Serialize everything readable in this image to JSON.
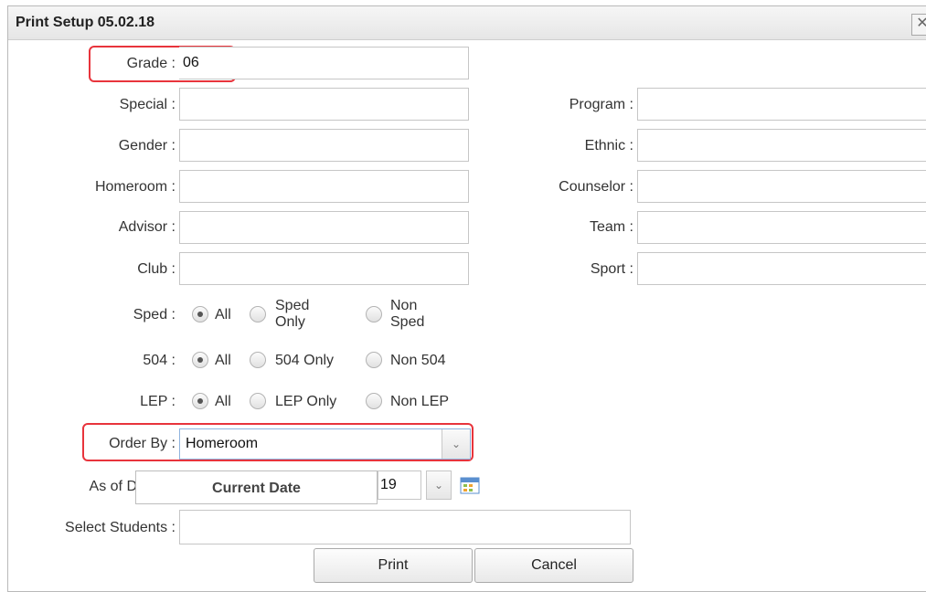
{
  "dialog": {
    "title": "Print Setup 05.02.18",
    "close_glyph": "✕"
  },
  "fields": {
    "grade": {
      "label": "Grade :",
      "value": "06"
    },
    "special": {
      "label": "Special :",
      "value": ""
    },
    "gender": {
      "label": "Gender :",
      "value": ""
    },
    "homeroom": {
      "label": "Homeroom :",
      "value": ""
    },
    "advisor": {
      "label": "Advisor :",
      "value": ""
    },
    "club": {
      "label": "Club :",
      "value": ""
    },
    "program": {
      "label": "Program :",
      "value": ""
    },
    "ethnic": {
      "label": "Ethnic :",
      "value": ""
    },
    "counselor": {
      "label": "Counselor :",
      "value": ""
    },
    "team": {
      "label": "Team :",
      "value": ""
    },
    "sport": {
      "label": "Sport :",
      "value": ""
    }
  },
  "radios": {
    "sped": {
      "label": "Sped :",
      "options": [
        "All",
        "Sped Only",
        "Non Sped"
      ],
      "opt2_line1": "Sped",
      "opt2_line2": "Only",
      "opt3_line1": "Non",
      "opt3_line2": "Sped",
      "selected": "All"
    },
    "504": {
      "label": "504 :",
      "options": [
        "All",
        "504 Only",
        "Non 504"
      ],
      "selected": "All"
    },
    "lep": {
      "label": "LEP :",
      "options": [
        "All",
        "LEP Only",
        "Non LEP"
      ],
      "selected": "All"
    }
  },
  "order_by": {
    "label": "Order By :",
    "value": "Homeroom"
  },
  "as_of": {
    "label_visible": "As of D",
    "overlay_text": "Current Date",
    "partial_value": "19"
  },
  "select_students": {
    "label": "Select Students :",
    "value": ""
  },
  "buttons": {
    "print": "Print",
    "cancel": "Cancel"
  },
  "colors": {
    "highlight": "#e8343c",
    "select_border": "#8fb3de"
  },
  "icons": {
    "calendar": "calendar-icon",
    "dropdown": "chevron-down-icon"
  }
}
